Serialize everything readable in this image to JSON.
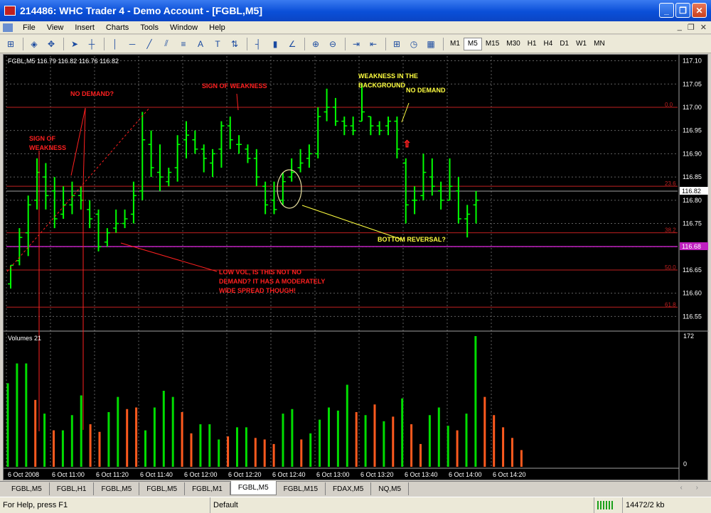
{
  "window": {
    "title": "214486: WHC Trader 4 - Demo Account - [FGBL,M5]"
  },
  "menu": [
    "File",
    "View",
    "Insert",
    "Charts",
    "Tools",
    "Window",
    "Help"
  ],
  "toolbar": {
    "icons": [
      "new-chart-icon",
      "market-watch-icon",
      "navigator-icon",
      "cursor-icon",
      "crosshair-icon",
      "vertical-line-icon",
      "horizontal-line-icon",
      "trendline-icon",
      "channel-icon",
      "fibonacci-icon",
      "text-icon",
      "text-label-icon",
      "arrows-icon",
      "bar-chart-icon",
      "candle-chart-icon",
      "line-chart-icon",
      "zoom-in-icon",
      "zoom-out-icon",
      "autoscroll-icon",
      "chart-shift-icon",
      "indicators-icon",
      "periods-icon",
      "templates-icon"
    ],
    "timeframes": [
      "M1",
      "M5",
      "M15",
      "M30",
      "H1",
      "H4",
      "D1",
      "W1",
      "MN"
    ],
    "active_timeframe": "M5"
  },
  "chart": {
    "header": "FGBL,M5  116.79 116.82 116.76 116.82",
    "current_price": "116.82",
    "magenta_price": "116.68",
    "volume_label": "Volumes 21",
    "volume_max_label": "172",
    "volume_zero_label": "0",
    "colors": {
      "background": "#000000",
      "bar": "#00ff00",
      "grid": "#606060",
      "fib": "#c02020",
      "magenta": "#c020c0",
      "annotation_red": "#ff2020",
      "annotation_yellow": "#ffff40",
      "volume_up": "#00dd00",
      "volume_down": "#ff5a1e"
    }
  },
  "annotations": {
    "sign_of_weakness_left": "SIGN OF WEAKNESS",
    "no_demand_left": "NO DEMAND?",
    "sign_of_weakness_mid": "SIGN OF WEAKNESS",
    "weakness_background": "WEAKNESS IN THE BACKGROUND",
    "no_demand_right": "NO DEMAND",
    "bottom_reversal": "BOTTOM REVERSAL?",
    "low_vol_text": "LOW VOL, IS THIS NOT NO DEMAND? IT HAS A MODERATELY WIDE SPREAD THOUGH!"
  },
  "chart_data": {
    "type": "bar",
    "symbol": "FGBL",
    "period": "M5",
    "y_ticks": [
      "117.10",
      "117.05",
      "117.00",
      "116.95",
      "116.90",
      "116.85",
      "116.80",
      "116.75",
      "116.70",
      "116.65",
      "116.60",
      "116.55"
    ],
    "ylim": [
      116.52,
      117.11
    ],
    "x_ticks": [
      "6 Oct 2008",
      "6 Oct 11:00",
      "6 Oct 11:20",
      "6 Oct 11:40",
      "6 Oct 12:00",
      "6 Oct 12:20",
      "6 Oct 12:40",
      "6 Oct 13:00",
      "6 Oct 13:20",
      "6 Oct 13:40",
      "6 Oct 14:00",
      "6 Oct 14:20"
    ],
    "fib_levels": [
      {
        "label": "0.0",
        "price": 117.0
      },
      {
        "label": "23.6",
        "price": 116.83
      },
      {
        "label": "38.2",
        "price": 116.73
      },
      {
        "label": "50.0",
        "price": 116.65
      },
      {
        "label": "61.8",
        "price": 116.57
      }
    ],
    "ohlc": [
      {
        "o": 116.62,
        "h": 116.66,
        "l": 116.61,
        "c": 116.66
      },
      {
        "o": 116.67,
        "h": 116.74,
        "l": 116.66,
        "c": 116.72
      },
      {
        "o": 116.73,
        "h": 116.81,
        "l": 116.68,
        "c": 116.79
      },
      {
        "o": 116.8,
        "h": 116.89,
        "l": 116.78,
        "c": 116.86
      },
      {
        "o": 116.85,
        "h": 116.88,
        "l": 116.78,
        "c": 116.81
      },
      {
        "o": 116.82,
        "h": 116.85,
        "l": 116.74,
        "c": 116.76
      },
      {
        "o": 116.77,
        "h": 116.83,
        "l": 116.76,
        "c": 116.79
      },
      {
        "o": 116.79,
        "h": 116.84,
        "l": 116.77,
        "c": 116.81
      },
      {
        "o": 116.81,
        "h": 116.83,
        "l": 116.78,
        "c": 116.8
      },
      {
        "o": 116.78,
        "h": 116.8,
        "l": 116.74,
        "c": 116.76
      },
      {
        "o": 116.77,
        "h": 116.78,
        "l": 116.69,
        "c": 116.7
      },
      {
        "o": 116.71,
        "h": 116.74,
        "l": 116.7,
        "c": 116.73
      },
      {
        "o": 116.74,
        "h": 116.78,
        "l": 116.73,
        "c": 116.75
      },
      {
        "o": 116.75,
        "h": 116.78,
        "l": 116.74,
        "c": 116.76
      },
      {
        "o": 116.77,
        "h": 116.84,
        "l": 116.75,
        "c": 116.81
      },
      {
        "o": 116.82,
        "h": 116.99,
        "l": 116.8,
        "c": 116.93
      },
      {
        "o": 116.92,
        "h": 116.95,
        "l": 116.85,
        "c": 116.87
      },
      {
        "o": 116.86,
        "h": 116.92,
        "l": 116.82,
        "c": 116.85
      },
      {
        "o": 116.84,
        "h": 116.87,
        "l": 116.83,
        "c": 116.86
      },
      {
        "o": 116.87,
        "h": 116.94,
        "l": 116.84,
        "c": 116.92
      },
      {
        "o": 116.93,
        "h": 116.97,
        "l": 116.89,
        "c": 116.94
      },
      {
        "o": 116.93,
        "h": 116.95,
        "l": 116.9,
        "c": 116.91
      },
      {
        "o": 116.91,
        "h": 116.92,
        "l": 116.86,
        "c": 116.89
      },
      {
        "o": 116.88,
        "h": 116.91,
        "l": 116.85,
        "c": 116.9
      },
      {
        "o": 116.91,
        "h": 116.97,
        "l": 116.87,
        "c": 116.96
      },
      {
        "o": 116.96,
        "h": 116.98,
        "l": 116.91,
        "c": 116.93
      },
      {
        "o": 116.92,
        "h": 116.94,
        "l": 116.9,
        "c": 116.92
      },
      {
        "o": 116.91,
        "h": 116.92,
        "l": 116.88,
        "c": 116.89
      },
      {
        "o": 116.89,
        "h": 116.91,
        "l": 116.83,
        "c": 116.85
      },
      {
        "o": 116.83,
        "h": 116.84,
        "l": 116.77,
        "c": 116.79
      },
      {
        "o": 116.8,
        "h": 116.84,
        "l": 116.77,
        "c": 116.78
      },
      {
        "o": 116.8,
        "h": 116.86,
        "l": 116.79,
        "c": 116.84
      },
      {
        "o": 116.85,
        "h": 116.89,
        "l": 116.84,
        "c": 116.86
      },
      {
        "o": 116.87,
        "h": 116.91,
        "l": 116.86,
        "c": 116.88
      },
      {
        "o": 116.89,
        "h": 116.92,
        "l": 116.87,
        "c": 116.9
      },
      {
        "o": 116.9,
        "h": 117.0,
        "l": 116.89,
        "c": 116.98
      },
      {
        "o": 116.99,
        "h": 117.04,
        "l": 116.97,
        "c": 117.0
      },
      {
        "o": 117.0,
        "h": 117.02,
        "l": 116.96,
        "c": 116.97
      },
      {
        "o": 116.97,
        "h": 116.98,
        "l": 116.94,
        "c": 116.96
      },
      {
        "o": 116.96,
        "h": 116.98,
        "l": 116.94,
        "c": 116.95
      },
      {
        "o": 116.97,
        "h": 117.05,
        "l": 116.97,
        "c": 116.99
      },
      {
        "o": 116.98,
        "h": 116.98,
        "l": 116.94,
        "c": 116.96
      },
      {
        "o": 116.96,
        "h": 116.97,
        "l": 116.94,
        "c": 116.95
      },
      {
        "o": 116.96,
        "h": 116.98,
        "l": 116.94,
        "c": 116.97
      },
      {
        "o": 116.97,
        "h": 116.98,
        "l": 116.89,
        "c": 116.91
      },
      {
        "o": 116.88,
        "h": 116.89,
        "l": 116.75,
        "c": 116.79
      },
      {
        "o": 116.8,
        "h": 116.83,
        "l": 116.77,
        "c": 116.8
      },
      {
        "o": 116.81,
        "h": 116.9,
        "l": 116.8,
        "c": 116.86
      },
      {
        "o": 116.85,
        "h": 116.89,
        "l": 116.81,
        "c": 116.83
      },
      {
        "o": 116.82,
        "h": 116.84,
        "l": 116.78,
        "c": 116.8
      },
      {
        "o": 116.8,
        "h": 116.89,
        "l": 116.8,
        "c": 116.83
      },
      {
        "o": 116.82,
        "h": 116.85,
        "l": 116.75,
        "c": 116.76
      },
      {
        "o": 116.76,
        "h": 116.79,
        "l": 116.72,
        "c": 116.77
      },
      {
        "o": 116.79,
        "h": 116.82,
        "l": 116.75,
        "c": 116.8
      }
    ],
    "volume_ylim": [
      0,
      172
    ],
    "volumes": [
      {
        "v": 110,
        "d": "up"
      },
      {
        "v": 136,
        "d": "up"
      },
      {
        "v": 136,
        "d": "up"
      },
      {
        "v": 88,
        "d": "down"
      },
      {
        "v": 70,
        "d": "up"
      },
      {
        "v": 48,
        "d": "down"
      },
      {
        "v": 48,
        "d": "up"
      },
      {
        "v": 68,
        "d": "up"
      },
      {
        "v": 94,
        "d": "up"
      },
      {
        "v": 56,
        "d": "down"
      },
      {
        "v": 46,
        "d": "down"
      },
      {
        "v": 72,
        "d": "up"
      },
      {
        "v": 92,
        "d": "up"
      },
      {
        "v": 76,
        "d": "down"
      },
      {
        "v": 78,
        "d": "down"
      },
      {
        "v": 48,
        "d": "up"
      },
      {
        "v": 78,
        "d": "up"
      },
      {
        "v": 100,
        "d": "up"
      },
      {
        "v": 92,
        "d": "up"
      },
      {
        "v": 72,
        "d": "down"
      },
      {
        "v": 44,
        "d": "down"
      },
      {
        "v": 56,
        "d": "up"
      },
      {
        "v": 56,
        "d": "up"
      },
      {
        "v": 36,
        "d": "up"
      },
      {
        "v": 40,
        "d": "down"
      },
      {
        "v": 52,
        "d": "up"
      },
      {
        "v": 52,
        "d": "up"
      },
      {
        "v": 38,
        "d": "down"
      },
      {
        "v": 36,
        "d": "down"
      },
      {
        "v": 30,
        "d": "down"
      },
      {
        "v": 70,
        "d": "up"
      },
      {
        "v": 76,
        "d": "up"
      },
      {
        "v": 36,
        "d": "down"
      },
      {
        "v": 44,
        "d": "up"
      },
      {
        "v": 62,
        "d": "up"
      },
      {
        "v": 78,
        "d": "up"
      },
      {
        "v": 74,
        "d": "up"
      },
      {
        "v": 108,
        "d": "up"
      },
      {
        "v": 72,
        "d": "down"
      },
      {
        "v": 68,
        "d": "up"
      },
      {
        "v": 82,
        "d": "down"
      },
      {
        "v": 60,
        "d": "up"
      },
      {
        "v": 66,
        "d": "down"
      },
      {
        "v": 90,
        "d": "up"
      },
      {
        "v": 56,
        "d": "down"
      },
      {
        "v": 30,
        "d": "down"
      },
      {
        "v": 68,
        "d": "up"
      },
      {
        "v": 78,
        "d": "up"
      },
      {
        "v": 54,
        "d": "up"
      },
      {
        "v": 48,
        "d": "down"
      },
      {
        "v": 70,
        "d": "up"
      },
      {
        "v": 172,
        "d": "up"
      },
      {
        "v": 92,
        "d": "down"
      },
      {
        "v": 68,
        "d": "down"
      },
      {
        "v": 52,
        "d": "down"
      },
      {
        "v": 38,
        "d": "down"
      },
      {
        "v": 22,
        "d": "down"
      }
    ]
  },
  "tabs": [
    "FGBL,M5",
    "FGBL,H1",
    "FGBL,M5",
    "FGBL,M5",
    "FGBL,M1",
    "FGBL,M5",
    "FGBL,M15",
    "FDAX,M5",
    "NQ,M5"
  ],
  "active_tab": 5,
  "status": {
    "help": "For Help, press F1",
    "profile": "Default",
    "traffic": "14472/2 kb"
  }
}
